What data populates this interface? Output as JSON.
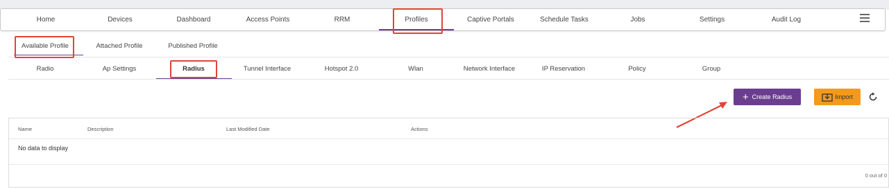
{
  "nav": {
    "items": [
      {
        "label": "Home"
      },
      {
        "label": "Devices"
      },
      {
        "label": "Dashboard"
      },
      {
        "label": "Access Points"
      },
      {
        "label": "RRM"
      },
      {
        "label": "Profiles"
      },
      {
        "label": "Captive Portals"
      },
      {
        "label": "Schedule Tasks"
      },
      {
        "label": "Jobs"
      },
      {
        "label": "Settings"
      },
      {
        "label": "Audit Log"
      }
    ],
    "active": "Profiles",
    "menu_icon": "hamburger-menu-icon"
  },
  "profile_tabs": {
    "items": [
      {
        "label": "Available Profile"
      },
      {
        "label": "Attached Profile"
      },
      {
        "label": "Published Profile"
      }
    ],
    "active": "Available Profile"
  },
  "sub_tabs": {
    "items": [
      {
        "label": "Radio"
      },
      {
        "label": "Ap Settings"
      },
      {
        "label": "Radius"
      },
      {
        "label": "Tunnel Interface"
      },
      {
        "label": "Hotspot 2.0"
      },
      {
        "label": "Wlan"
      },
      {
        "label": "Network Interface"
      },
      {
        "label": "IP Reservation"
      },
      {
        "label": "Policy"
      },
      {
        "label": "Group"
      }
    ],
    "active": "Radius"
  },
  "actions": {
    "create_label": "Create Radius",
    "import_label": "Import",
    "refresh_icon": "refresh-icon"
  },
  "table": {
    "columns": [
      "Name",
      "Description",
      "Last Modified Date",
      "Actions"
    ],
    "empty_text": "No data to display",
    "pager_text": "0 out of 0"
  },
  "colors": {
    "accent": "#6b3d8e",
    "import": "#f29a1e",
    "annotation": "#e04436"
  }
}
